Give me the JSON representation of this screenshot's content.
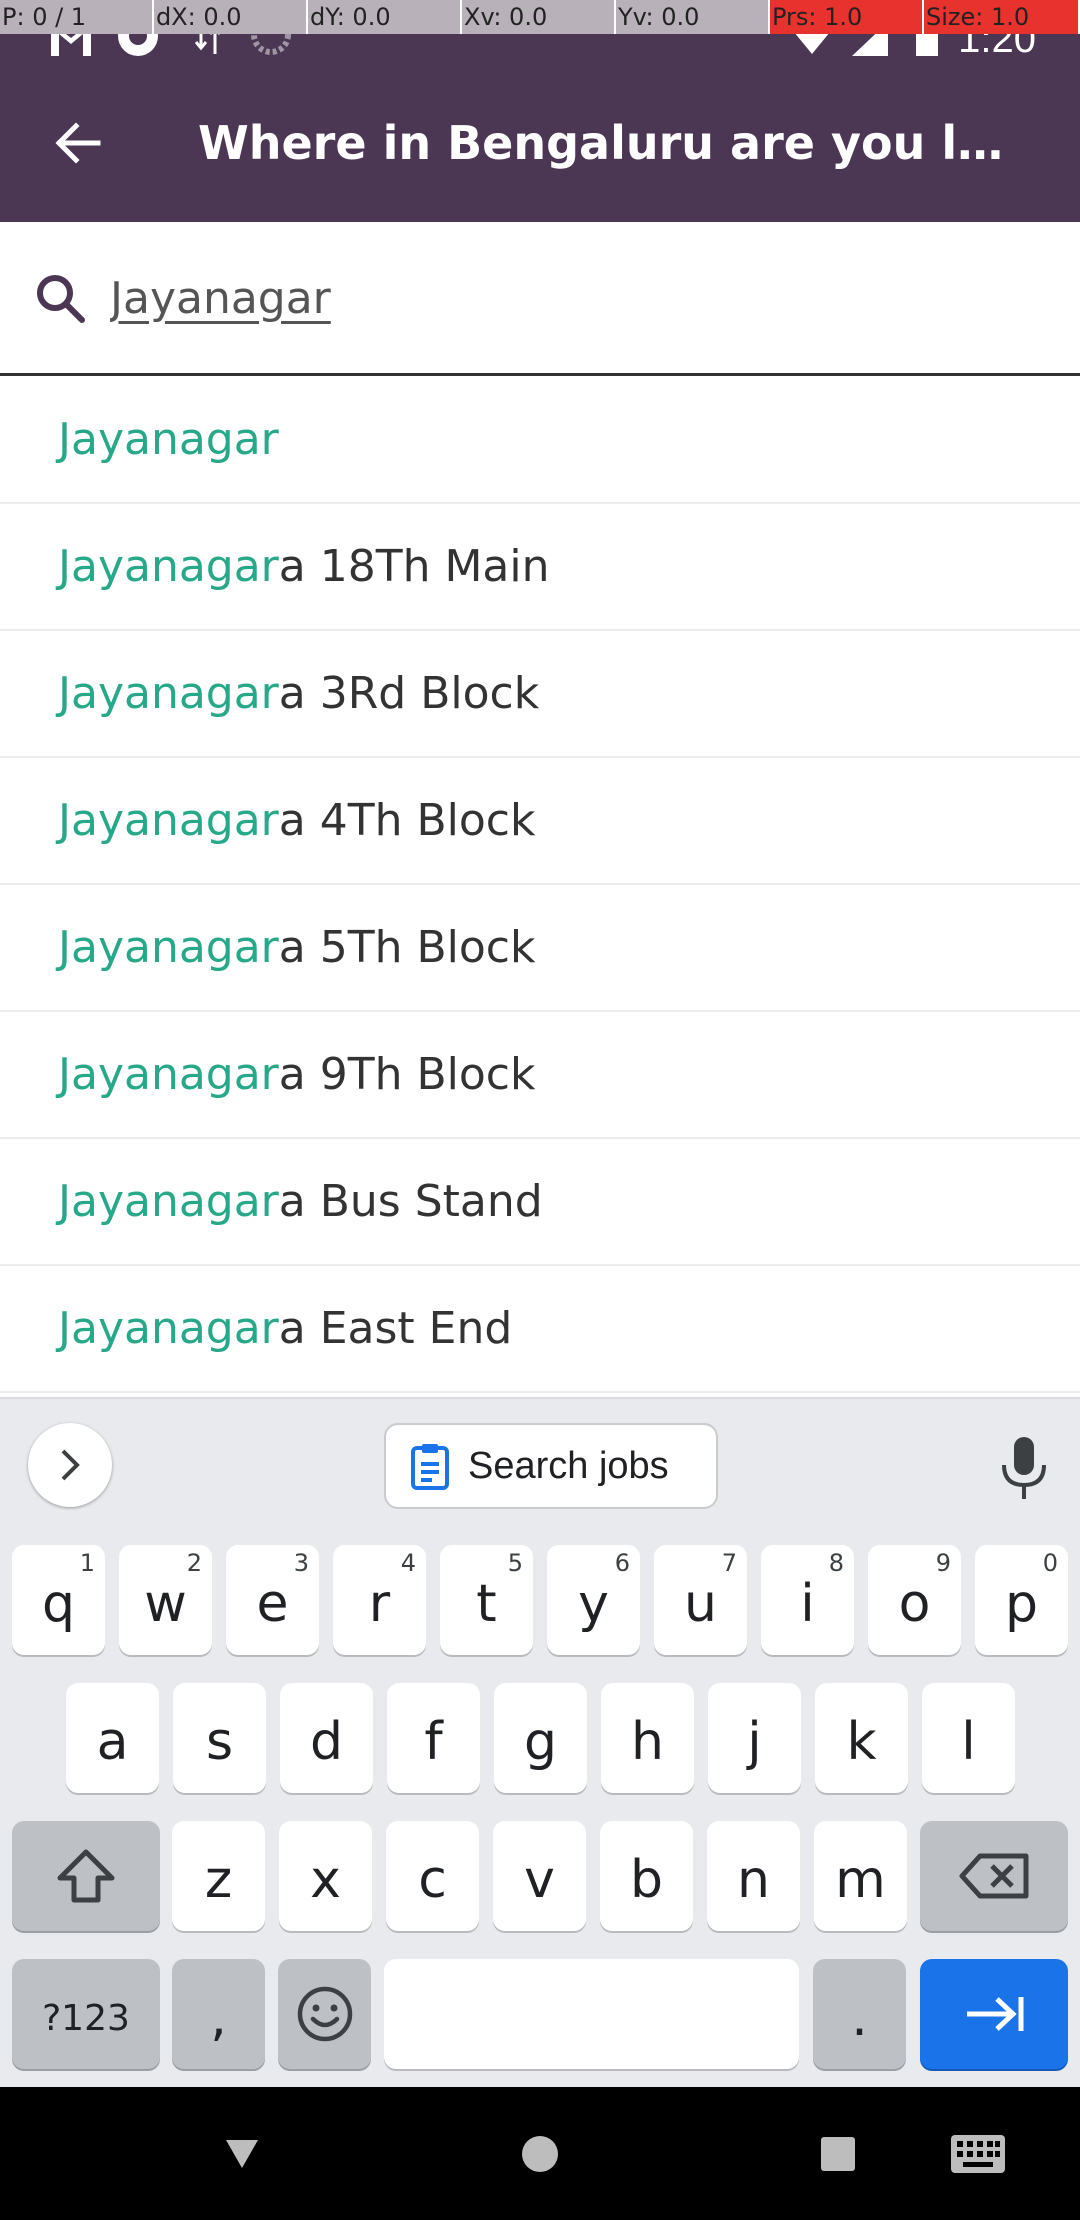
{
  "debug_overlay": {
    "pointer": "P: 0 / 1",
    "dx": "dX: 0.0",
    "dy": "dY: 0.0",
    "xv": "Xv: 0.0",
    "yv": "Yv: 0.0",
    "prs": "Prs: 1.0",
    "size": "Size: 1.0"
  },
  "status_bar": {
    "time": "1:20",
    "icons": [
      "gmail-icon",
      "sync-icon",
      "data-transfer-icon",
      "loading-icon",
      "wifi-icon",
      "signal-icon",
      "battery-icon"
    ]
  },
  "toolbar": {
    "title": "Where in Bengaluru are you lo…",
    "color": "#4b3653"
  },
  "search": {
    "value": "Jayanagar"
  },
  "suggestions": [
    {
      "match": "Jayanagar",
      "rest": ""
    },
    {
      "match": "Jayanagar",
      "rest": "a 18Th Main"
    },
    {
      "match": "Jayanagar",
      "rest": "a 3Rd Block"
    },
    {
      "match": "Jayanagar",
      "rest": "a 4Th Block"
    },
    {
      "match": "Jayanagar",
      "rest": "a 5Th Block"
    },
    {
      "match": "Jayanagar",
      "rest": "a 9Th Block"
    },
    {
      "match": "Jayanagar",
      "rest": "a Bus Stand"
    },
    {
      "match": "Jayanagar",
      "rest": "a East End"
    }
  ],
  "highlight_color": "#26a889",
  "keyboard": {
    "chip_label": "Search jobs",
    "row1": [
      {
        "key": "q",
        "hint": "1"
      },
      {
        "key": "w",
        "hint": "2"
      },
      {
        "key": "e",
        "hint": "3"
      },
      {
        "key": "r",
        "hint": "4"
      },
      {
        "key": "t",
        "hint": "5"
      },
      {
        "key": "y",
        "hint": "6"
      },
      {
        "key": "u",
        "hint": "7"
      },
      {
        "key": "i",
        "hint": "8"
      },
      {
        "key": "o",
        "hint": "9"
      },
      {
        "key": "p",
        "hint": "0"
      }
    ],
    "row2": [
      "a",
      "s",
      "d",
      "f",
      "g",
      "h",
      "j",
      "k",
      "l"
    ],
    "row3": [
      "z",
      "x",
      "c",
      "v",
      "b",
      "n",
      "m"
    ],
    "symbols_label": "?123",
    "comma": ",",
    "period": ".",
    "action_color": "#1a73e8"
  }
}
